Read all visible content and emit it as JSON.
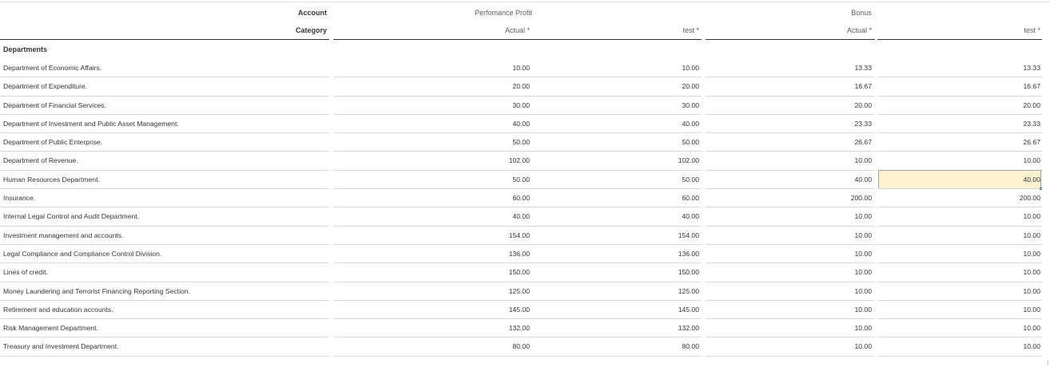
{
  "header": {
    "account_label": "Account",
    "category_label": "Category",
    "group1": "Perfomance Profit",
    "group2": "Bonus",
    "col1": "Actual *",
    "col2": "test *",
    "col3": "Actual *",
    "col4": "test *"
  },
  "section_title": "Departments",
  "selected": {
    "row": 6,
    "col": 3
  },
  "rows": [
    {
      "name": "Department of Economic Affairs.",
      "v": [
        "10.00",
        "10.00",
        "13.33",
        "13.33"
      ]
    },
    {
      "name": "Department of Expenditure.",
      "v": [
        "20.00",
        "20.00",
        "16.67",
        "16.67"
      ]
    },
    {
      "name": "Department of Financial Services.",
      "v": [
        "30.00",
        "30.00",
        "20.00",
        "20.00"
      ]
    },
    {
      "name": "Department of Investment and Public Asset Management.",
      "v": [
        "40.00",
        "40.00",
        "23.33",
        "23.33"
      ]
    },
    {
      "name": "Department of Public Enterprise.",
      "v": [
        "50.00",
        "50.00",
        "26.67",
        "26.67"
      ]
    },
    {
      "name": "Department of Revenue.",
      "v": [
        "102.00",
        "102.00",
        "10.00",
        "10.00"
      ]
    },
    {
      "name": "Human Resources Department.",
      "v": [
        "50.00",
        "50.00",
        "40.00",
        "40.00"
      ]
    },
    {
      "name": "Insurance.",
      "v": [
        "60.00",
        "60.00",
        "200.00",
        "200.00"
      ]
    },
    {
      "name": "Internal Legal Control and Audit Department.",
      "v": [
        "40.00",
        "40.00",
        "10.00",
        "10.00"
      ]
    },
    {
      "name": "Investment management and accounts.",
      "v": [
        "154.00",
        "154.00",
        "10.00",
        "10.00"
      ]
    },
    {
      "name": "Legal Compliance and Compliance Control Division.",
      "v": [
        "136.00",
        "136.00",
        "10.00",
        "10.00"
      ]
    },
    {
      "name": "Lines of credit.",
      "v": [
        "150.00",
        "150.00",
        "10.00",
        "10.00"
      ]
    },
    {
      "name": "Money Laundering and Terrorist Financing Reporting Section.",
      "v": [
        "125.00",
        "125.00",
        "10.00",
        "10.00"
      ]
    },
    {
      "name": "Retirement and education accounts.",
      "v": [
        "145.00",
        "145.00",
        "10.00",
        "10.00"
      ]
    },
    {
      "name": "Risk Management Department.",
      "v": [
        "132.00",
        "132.00",
        "10.00",
        "10.00"
      ]
    },
    {
      "name": "Treasury and Investment Department.",
      "v": [
        "80.00",
        "80.00",
        "10.00",
        "10.00"
      ]
    }
  ]
}
